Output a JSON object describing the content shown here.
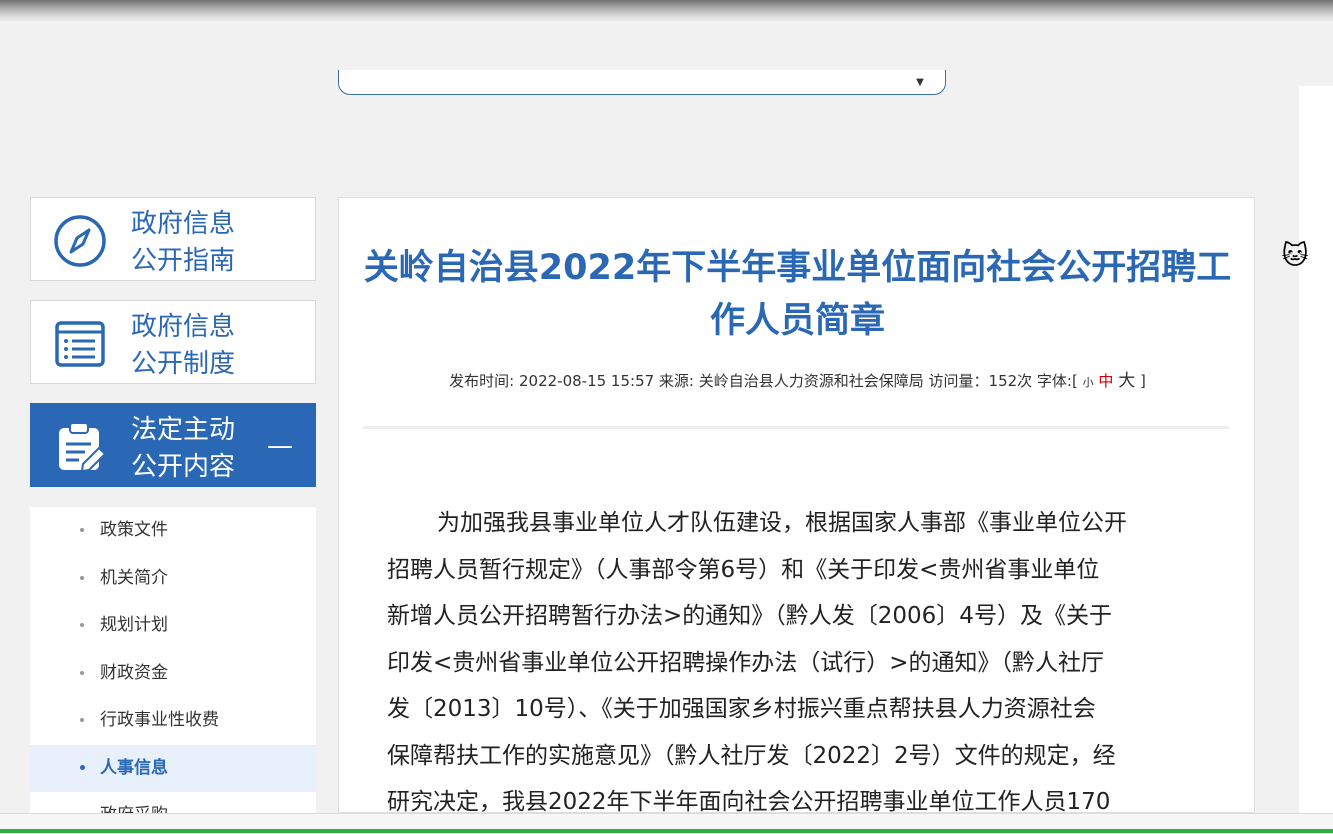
{
  "sidebar": {
    "cards": [
      {
        "label": "政府信息\n公开指南",
        "icon": "compass-icon"
      },
      {
        "label": "政府信息\n公开制度",
        "icon": "list-document-icon"
      },
      {
        "label": "法定主动\n公开内容",
        "icon": "clipboard-edit-icon",
        "active": true
      }
    ],
    "collapse_symbol": "—",
    "sub_items": [
      {
        "label": "政策文件"
      },
      {
        "label": "机关简介"
      },
      {
        "label": "规划计划"
      },
      {
        "label": "财政资金"
      },
      {
        "label": "行政事业性收费"
      },
      {
        "label": "人事信息",
        "active": true
      },
      {
        "label": "政府采购"
      }
    ]
  },
  "article": {
    "title": "关岭自治县2022年下半年事业单位面向社会公开招聘工作人员简章",
    "meta": {
      "prefix": "发布时间: 2022-08-15 15:57 来源: 关岭自治县人力资源和社会保障局 访问量：152次 字体:[",
      "size_small": "小",
      "size_medium": "中",
      "size_large": "大",
      "suffix": "]"
    },
    "body_lines": [
      "为加强我县事业单位人才队伍建设，根据国家人事部《事业单位公开",
      "招聘人员暂行规定》（人事部令第6号）和《关于印发<贵州省事业单位",
      "新增人员公开招聘暂行办法>的通知》（黔人发〔2006〕4号）及《关于",
      "印发<贵州省事业单位公开招聘操作办法（试行）>的通知》（黔人社厅",
      "发〔2013〕10号）、《关于加强国家乡村振兴重点帮扶县人力资源社会",
      "保障帮扶工作的实施意见》（黔人社厅发〔2022〕2号）文件的规定，经",
      "研究决定，我县2022年下半年面向社会公开招聘事业单位工作人员170"
    ]
  },
  "colors": {
    "brand_blue": "#2a68b6",
    "active_bg": "#e8f1fb",
    "accent_red": "#cc0000",
    "page_bg": "#f1f1f1"
  }
}
